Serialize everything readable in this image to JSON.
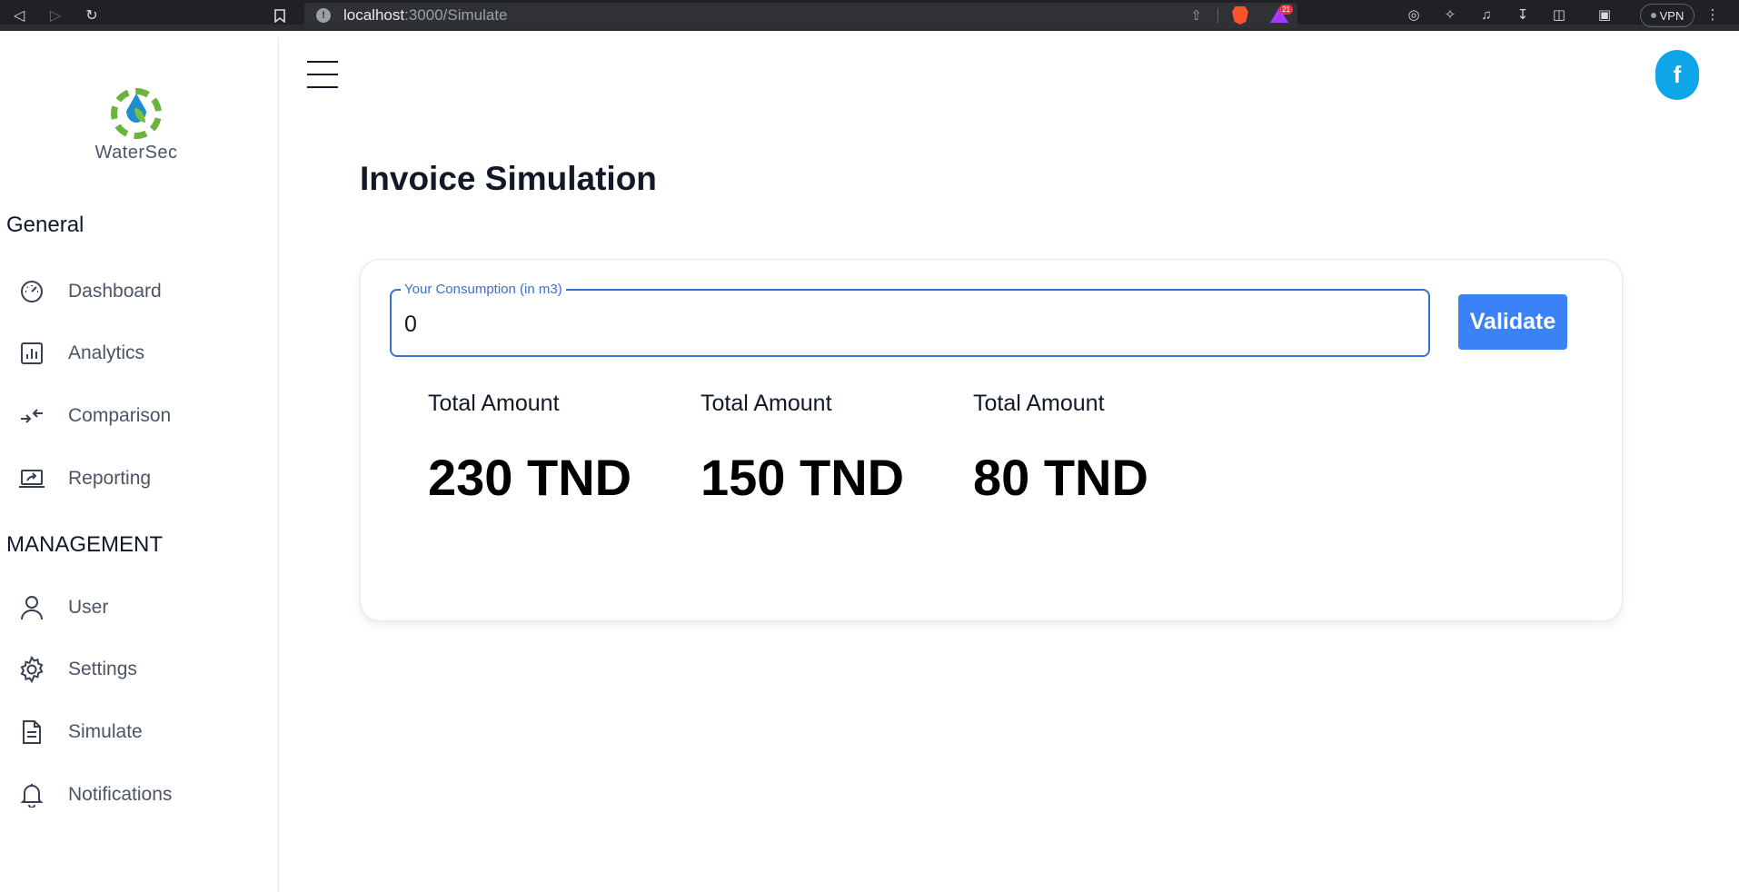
{
  "browser": {
    "url_host": "localhost",
    "url_path": ":3000/Simulate",
    "rewards_badge": "21",
    "vpn_label": "VPN"
  },
  "sidebar": {
    "brand": "WaterSec",
    "sections": [
      {
        "title": "General",
        "items": [
          {
            "label": "Dashboard",
            "icon": "dashboard-gauge-icon"
          },
          {
            "label": "Analytics",
            "icon": "bar-chart-icon"
          },
          {
            "label": "Comparison",
            "icon": "compare-arrows-icon"
          },
          {
            "label": "Reporting",
            "icon": "laptop-share-icon"
          }
        ]
      },
      {
        "title": "MANAGEMENT",
        "items": [
          {
            "label": "User",
            "icon": "user-icon"
          },
          {
            "label": "Settings",
            "icon": "gear-icon"
          },
          {
            "label": "Simulate",
            "icon": "document-icon"
          },
          {
            "label": "Notifications",
            "icon": "bell-icon"
          }
        ]
      }
    ]
  },
  "header": {
    "avatar_letter": "f",
    "avatar_color": "#0ea5e9"
  },
  "main": {
    "title": "Invoice Simulation",
    "consumption_label": "Your Consumption (in m3)",
    "consumption_value": "0",
    "validate_label": "Validate",
    "amounts": [
      {
        "label": "Total Amount",
        "value": "230 TND"
      },
      {
        "label": "Total Amount",
        "value": "150 TND"
      },
      {
        "label": "Total Amount",
        "value": "80 TND"
      }
    ]
  },
  "colors": {
    "accent": "#3b82f6",
    "input_border": "#3b6fd1",
    "logo_green": "#6cb33e",
    "logo_blue": "#1f8ecb"
  }
}
